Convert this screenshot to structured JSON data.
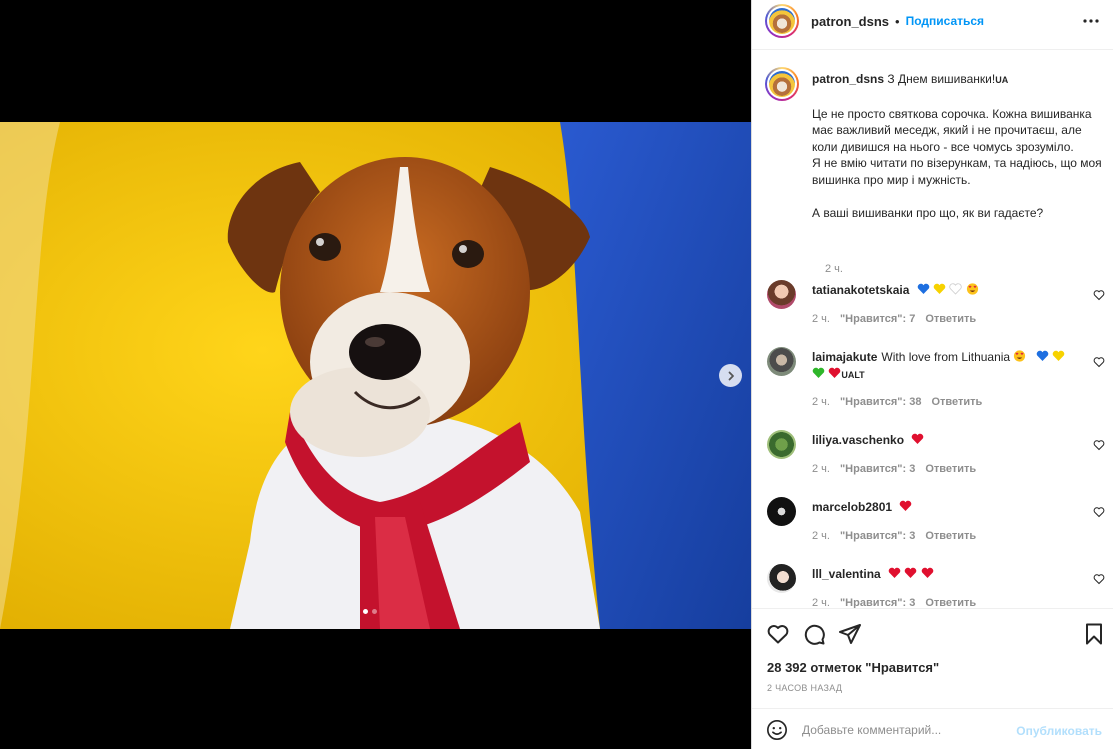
{
  "post": {
    "watermark": "patron_dsns",
    "carousel_dots": 2,
    "active_dot": 1
  },
  "header": {
    "username": "patron_dsns",
    "separator": "•",
    "follow_label": "Подписаться"
  },
  "caption": {
    "username": "patron_dsns",
    "headline": "З Днем вишиванки!",
    "headline_suffix": "UA",
    "text": "Це не просто святкова сорочка. Кожна вишиванка має важливий меседж, який і не прочитаєш, але коли дивишся на нього - все чомусь зрозуміло.\nЯ не вмію читати по візерункам, та надіюсь, що моя вишинка про мир і мужність.\n\nА ваші вишиванки про що, як ви гадаєте?",
    "time": "2 ч."
  },
  "comments": [
    {
      "username": "tatianakotetskaia",
      "text": "",
      "time": "2 ч.",
      "likes": "\"Нравится\": 7",
      "reply": "Ответить",
      "emoji": [
        "blue-heart",
        "yellow-heart",
        "white-heart",
        "heart-eyes"
      ]
    },
    {
      "username": "laimajakute",
      "text": "With love from Lithuania",
      "extra_text": "UALT",
      "time": "2 ч.",
      "likes": "\"Нравится\": 38",
      "reply": "Ответить",
      "emoji": [
        "heart-eyes",
        "blue-heart",
        "yellow-heart",
        "green-heart",
        "red-heart"
      ]
    },
    {
      "username": "liliya.vaschenko",
      "text": "",
      "time": "2 ч.",
      "likes": "\"Нравится\": 3",
      "reply": "Ответить",
      "emoji": [
        "red-heart"
      ]
    },
    {
      "username": "marcelob2801",
      "text": "",
      "time": "2 ч.",
      "likes": "\"Нравится\": 3",
      "reply": "Ответить",
      "emoji": [
        "red-heart"
      ]
    },
    {
      "username": "lll_valentina",
      "text": "",
      "time": "2 ч.",
      "likes": "\"Нравится\": 3",
      "reply": "Ответить",
      "emoji": [
        "red-heart",
        "red-heart",
        "red-heart"
      ]
    }
  ],
  "stats": {
    "likes": "28 392 отметок \"Нравится\"",
    "time_ago": "2 ЧАСОВ НАЗАД"
  },
  "comment_box": {
    "placeholder": "Добавьте комментарий...",
    "post_label": "Опубликовать"
  },
  "colors": {
    "accent": "#0095f6",
    "post_disabled": "#b2dffc",
    "ukraine_yellow": "#f5c400",
    "ukraine_blue": "#1f4fc0"
  }
}
